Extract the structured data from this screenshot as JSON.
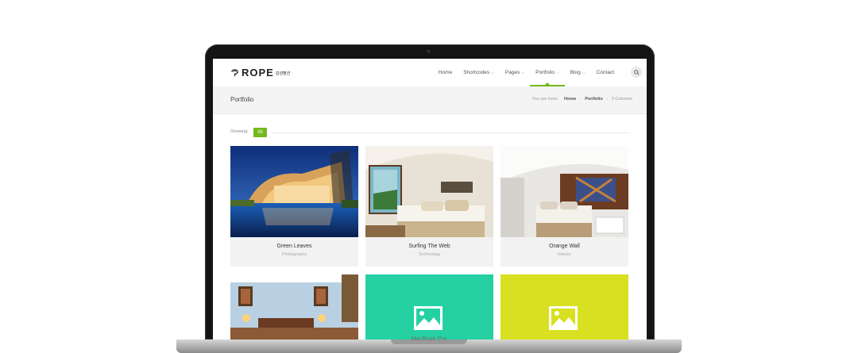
{
  "site": {
    "logo_text": "ROPE",
    "logo_sub": "감성펜션"
  },
  "nav": {
    "items": [
      {
        "label": "Home",
        "dropdown": false,
        "active": false
      },
      {
        "label": "Shortcodes",
        "dropdown": true,
        "active": false
      },
      {
        "label": "Pages",
        "dropdown": true,
        "active": false
      },
      {
        "label": "Portfolio",
        "dropdown": true,
        "active": true
      },
      {
        "label": "Blog",
        "dropdown": true,
        "active": false
      },
      {
        "label": "Contact",
        "dropdown": false,
        "active": false
      }
    ],
    "search_icon": "search-icon"
  },
  "title_bar": {
    "title": "Portfolio",
    "breadcrumb_prefix": "You are here:",
    "crumb_home": "Home",
    "crumb_portfolio": "Portfolio",
    "crumb_current": "3 Columns"
  },
  "filter": {
    "label": "Showing:",
    "active": "All"
  },
  "portfolio": {
    "items": [
      {
        "title": "Green Leaves",
        "category": "Photography"
      },
      {
        "title": "Surfing The Web",
        "category": "Technology"
      },
      {
        "title": "Orange Wall",
        "category": "Interior"
      }
    ],
    "second_row": [
      {
        "type": "photo"
      },
      {
        "type": "placeholder",
        "color": "#25d1a3"
      },
      {
        "type": "placeholder",
        "color": "#d9e021"
      }
    ]
  },
  "device": {
    "label": "MacBook Pro"
  },
  "colors": {
    "accent": "#72b91b"
  }
}
